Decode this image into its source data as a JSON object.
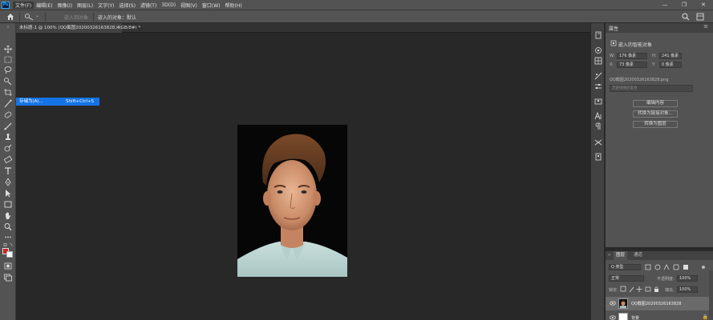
{
  "app": {
    "logo_text": "Ps"
  },
  "menu": [
    "文件(F)",
    "编辑(E)",
    "图像(I)",
    "图层(L)",
    "文字(Y)",
    "选择(S)",
    "滤镜(T)",
    "3D(D)",
    "视图(V)",
    "窗口(W)",
    "帮助(H)"
  ],
  "window_controls": {
    "minimize": "—",
    "restore": "❐",
    "close": "✕"
  },
  "options_bar": {
    "option_1": "嵌入到对象",
    "option_2": "嵌入的对象：默认"
  },
  "document_tab": {
    "title": "未标题-1 @ 100% (QQ截图20200326163828, RGB/8#) *",
    "close": "×"
  },
  "flyout": {
    "label": "存储为(A)...",
    "shortcut": "Shift+Ctrl+S"
  },
  "colors": {
    "foreground": "#c8261c",
    "background": "#ffffff",
    "accent": "#1473e6"
  },
  "properties": {
    "tab": "属性",
    "menu_icon": "≡",
    "title": "嵌入的智能对象",
    "w_label": "W:",
    "w_value": "176 像素",
    "h_label": "H:",
    "h_value": "241 像素",
    "x_label": "X:",
    "x_value": "73 像素",
    "y_label": "Y:",
    "y_value": "0 像素",
    "file_name": "QQ截图20200326163828.png",
    "path_placeholder": "无链接图层复合",
    "buttons": [
      "编辑内容",
      "转换为链接对象...",
      "转换为图层"
    ]
  },
  "layers_panel": {
    "tabs": [
      "图层",
      "通道"
    ],
    "filter_kind": "Q 类型",
    "blend_mode": "正常",
    "opacity_label": "不透明度:",
    "opacity_value": "100%",
    "lock_label": "锁定:",
    "fill_label": "填充:",
    "fill_value": "100%",
    "layers": [
      {
        "name": "QQ截图20200326163828",
        "selected": true
      },
      {
        "name": "背景",
        "selected": false,
        "locked_icon": "🔒"
      }
    ]
  }
}
